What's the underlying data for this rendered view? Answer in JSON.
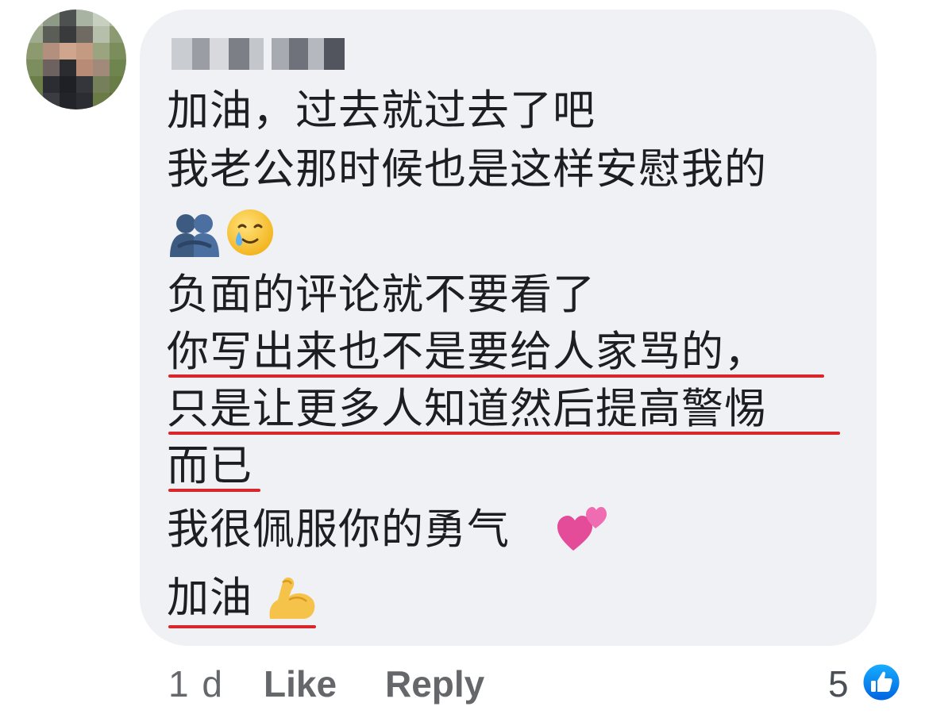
{
  "comment": {
    "lines": [
      "加油，过去就过去了吧",
      "我老公那时候也是这样安慰我的",
      "负面的评论就不要看了",
      "你写出来也不是要给人家骂的，",
      "只是让更多人知道然后提高警惕",
      "而已",
      "我很佩服你的勇气",
      "加油"
    ],
    "emojis": [
      "hugging-people-emoji",
      "smiling-face-with-tear-emoji",
      "two-hearts-emoji",
      "flexed-biceps-emoji"
    ]
  },
  "footer": {
    "time": "1 d",
    "like_label": "Like",
    "reply_label": "Reply",
    "reaction_count": "5"
  },
  "colors": {
    "bubble": "#eff1f4",
    "text": "#1c1e21",
    "meta": "#65676b",
    "underline": "#d8262b",
    "like_blue": "#1877f2"
  }
}
